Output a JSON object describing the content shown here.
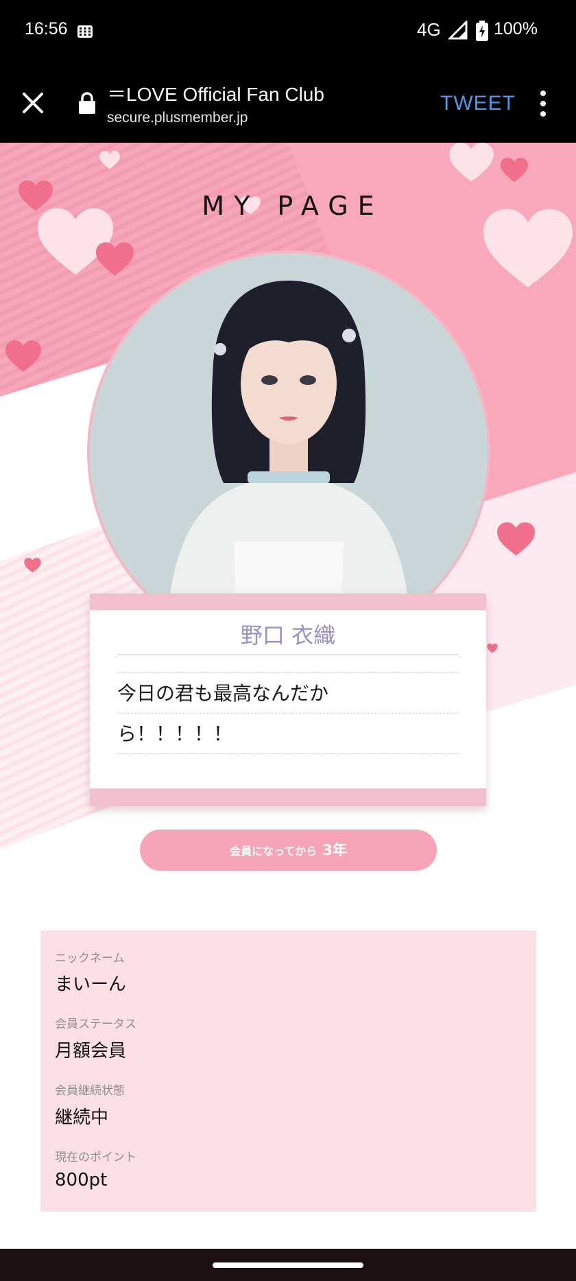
{
  "status_bar": {
    "time": "16:56",
    "network": "4G",
    "battery": "100%",
    "icons": [
      "grid-icon",
      "signal-icon",
      "battery-charging-icon"
    ]
  },
  "browser": {
    "title": "＝LOVE Official Fan Club",
    "url": "secure.plusmember.jp",
    "tweet_label": "TWEET",
    "icons": [
      "close-icon",
      "lock-icon",
      "more-vertical-icon"
    ],
    "accent_color": "#4e9ae6"
  },
  "page": {
    "heading": "MY PAGE",
    "colors": {
      "pink_primary": "#f8a4b8",
      "pink_light": "#fde0e6",
      "name_color": "#9a8fc8"
    }
  },
  "profile": {
    "name": "野口 衣織",
    "message_lines": [
      "今日の君も最高なんだか",
      "ら！！！！！"
    ]
  },
  "membership": {
    "duration_label": "会員になってから",
    "duration_value": "3年"
  },
  "info": {
    "nickname_label": "ニックネーム",
    "nickname": "まいーん",
    "status_label": "会員ステータス",
    "status": "月額会員",
    "continuation_label": "会員継続状態",
    "continuation": "継続中",
    "points_label": "現在のポイント",
    "points": "800pt"
  }
}
